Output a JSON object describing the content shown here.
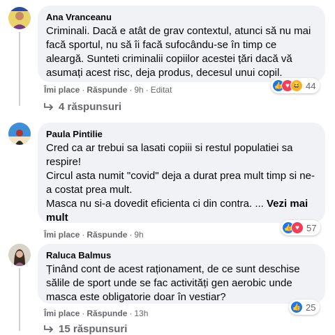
{
  "comments": [
    {
      "author": "Ana Vranceanu",
      "text": [
        "Criminali. Dacă e atât de grav contextul, atunci să nu mai facă sportul, nu să îi facă sufocându-se în timp ce aleargă. Sunteti criminalii copiilor acestei țări dacă vă asumați acest risc, deja produs, decesul unui copil."
      ],
      "see_more": "",
      "like_label": "Îmi place",
      "reply_label": "Răspunde",
      "time": "9h",
      "edited": "Editat",
      "reaction_count": "44",
      "reaction_icons": [
        "like-reaction-icon",
        "love-reaction-icon",
        "haha-reaction-icon"
      ],
      "replies": "4 răspunsuri"
    },
    {
      "author": "Paula Pintilie",
      "text": [
        "Cred ca ar trebui sa lasati copiii si restul populatiei sa respire!",
        "Circul asta numit \"covid\" deja a durat prea mult timp si ne-a costat prea mult.",
        "Masca nu si-a dovedit eficienta ci din contra. ..."
      ],
      "see_more": "Vezi mai mult",
      "like_label": "Îmi place",
      "reply_label": "Răspunde",
      "time": "9h",
      "reaction_count": "57",
      "reaction_icons": [
        "like-reaction-icon",
        "love-reaction-icon"
      ]
    },
    {
      "author": "Raluca Balmus",
      "text": [
        "Ținând cont de acest raționament, de ce sunt deschise sălile de sport unde se fac activități gen aerobic unde masca este obligatorie doar în vestiar?"
      ],
      "see_more": "",
      "like_label": "Îmi place",
      "reply_label": "Răspunde",
      "time": "13h",
      "reaction_count": "25",
      "reaction_icons": [
        "like-reaction-icon"
      ],
      "replies": "15 răspunsuri"
    }
  ],
  "colors": {
    "like": "#1877f2",
    "love": "#f33e58",
    "haha": "#f7b125",
    "bubble": "#f0f2f5",
    "meta": "#65676b"
  }
}
